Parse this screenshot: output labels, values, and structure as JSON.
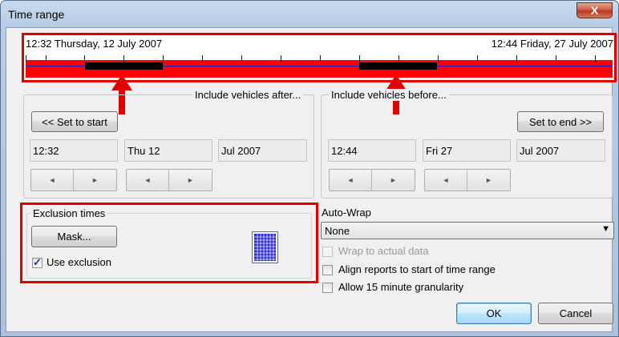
{
  "window": {
    "title": "Time range",
    "close_symbol": "X"
  },
  "timeline": {
    "start_label": "12:32 Thursday, 12 July 2007",
    "end_label": "12:44 Friday, 27 July 2007",
    "colors": {
      "border": "#e00000",
      "track": "#ff0000",
      "selection": "#000000",
      "axis": "#2020c0"
    }
  },
  "after_group": {
    "label": "Include vehicles after...",
    "set_button": "<< Set to start",
    "time": "12:32",
    "day": "Thu 12",
    "month_year": "Jul 2007"
  },
  "before_group": {
    "label": "Include vehicles before...",
    "set_button": "Set to end >>",
    "time": "12:44",
    "day": "Fri 27",
    "month_year": "Jul 2007"
  },
  "spin": {
    "left": "◄",
    "right": "►"
  },
  "exclusion": {
    "label": "Exclusion times",
    "mask_button": "Mask...",
    "use_exclusion_label": "Use exclusion",
    "use_exclusion_checked": true
  },
  "auto_wrap": {
    "label": "Auto-Wrap",
    "selected": "None",
    "dropdown_icon": "▼",
    "wrap_actual_label": "Wrap to actual data",
    "align_label": "Align reports to start of time range",
    "granularity_label": "Allow 15 minute granularity"
  },
  "footer": {
    "ok": "OK",
    "cancel": "Cancel"
  }
}
